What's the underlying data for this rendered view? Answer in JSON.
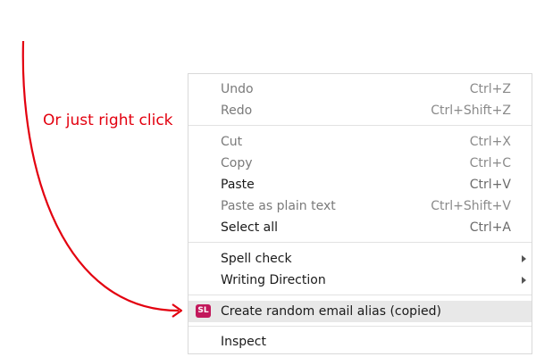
{
  "annotation": {
    "text": "Or just right click",
    "color": "#e3000f"
  },
  "menu": {
    "items": [
      {
        "label": "Undo",
        "shortcut": "Ctrl+Z",
        "disabled": true
      },
      {
        "label": "Redo",
        "shortcut": "Ctrl+Shift+Z",
        "disabled": true
      },
      {
        "label": "Cut",
        "shortcut": "Ctrl+X",
        "disabled": true
      },
      {
        "label": "Copy",
        "shortcut": "Ctrl+C",
        "disabled": true
      },
      {
        "label": "Paste",
        "shortcut": "Ctrl+V",
        "disabled": false
      },
      {
        "label": "Paste as plain text",
        "shortcut": "Ctrl+Shift+V",
        "disabled": true
      },
      {
        "label": "Select all",
        "shortcut": "Ctrl+A",
        "disabled": false
      },
      {
        "label": "Spell check",
        "submenu": true
      },
      {
        "label": "Writing Direction",
        "submenu": true
      },
      {
        "label": "Create random email alias (copied)",
        "icon": "simplelogin-icon",
        "icon_text": "SL",
        "highlighted": true
      },
      {
        "label": "Inspect"
      }
    ],
    "highlight_color": "#e8e8e8",
    "icon_color": "#c2185b"
  }
}
